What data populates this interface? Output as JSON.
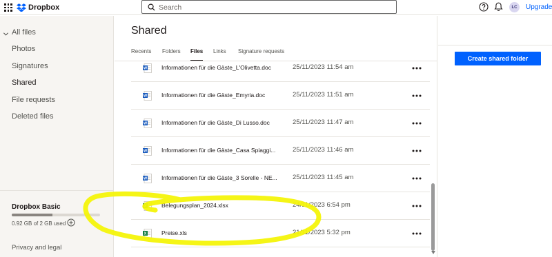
{
  "header": {
    "logo_text": "Dropbox",
    "search_placeholder": "Search",
    "avatar_initials": "LC",
    "upgrade_label": "Upgrade"
  },
  "sidebar": {
    "items": [
      {
        "label": "All files"
      },
      {
        "label": "Photos"
      },
      {
        "label": "Signatures"
      },
      {
        "label": "Shared"
      },
      {
        "label": "File requests"
      },
      {
        "label": "Deleted files"
      }
    ],
    "plan": {
      "title": "Dropbox Basic",
      "usage": "0.92 GB of 2 GB used",
      "usage_fraction": 0.46
    },
    "privacy_label": "Privacy and legal"
  },
  "main": {
    "title": "Shared",
    "tabs": [
      {
        "label": "Recents"
      },
      {
        "label": "Folders"
      },
      {
        "label": "Files"
      },
      {
        "label": "Links"
      },
      {
        "label": "Signature requests"
      }
    ],
    "active_tab": "Files",
    "files": [
      {
        "name": "Informationen für die Gäste_L'Olivetta.doc",
        "date": "25/11/2023 11:54 am",
        "type": "word"
      },
      {
        "name": "Informationen für die Gäste_Emyria.doc",
        "date": "25/11/2023 11:51 am",
        "type": "word"
      },
      {
        "name": "Informationen für die Gäste_Di Lusso.doc",
        "date": "25/11/2023 11:47 am",
        "type": "word"
      },
      {
        "name": "Informationen für die Gäste_Casa Spiaggi...",
        "date": "25/11/2023 11:46 am",
        "type": "word"
      },
      {
        "name": "Informationen für die Gäste_3 Sorelle - NE...",
        "date": "25/11/2023 11:45 am",
        "type": "word"
      },
      {
        "name": "Belegungsplan_2024.xlsx",
        "date": "24/11/2023 6:54 pm",
        "type": "excel"
      },
      {
        "name": "Preise.xls",
        "date": "21/11/2023 5:32 pm",
        "type": "excel"
      }
    ]
  },
  "actions": {
    "create_shared_folder_label": "Create shared folder"
  },
  "colors": {
    "accent": "#0061fe",
    "word_icon": "#185abd",
    "excel_icon": "#107c41",
    "annotation": "#f4f40a"
  }
}
